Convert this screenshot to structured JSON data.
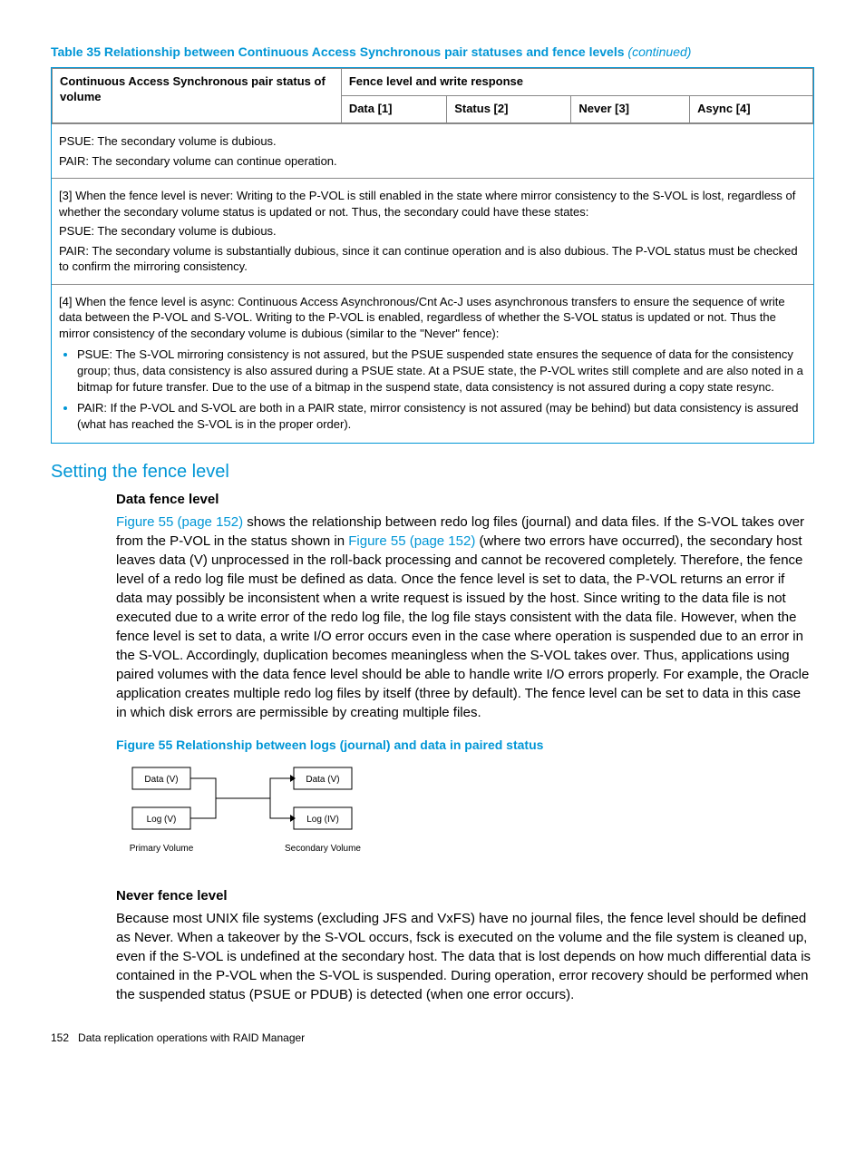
{
  "table": {
    "caption_main": "Table 35 Relationship between Continuous Access Synchronous pair statuses and fence levels",
    "caption_suffix": "(continued)",
    "row_header": "Continuous Access Synchronous pair status of volume",
    "group_header": "Fence level and write response",
    "cols": [
      "Data [1]",
      "Status [2]",
      "Never [3]",
      "Async [4]"
    ],
    "note2a": "PSUE: The secondary volume is dubious.",
    "note2b": "PAIR: The secondary volume can continue operation.",
    "note3a": "[3] When the fence level is never: Writing to the P-VOL is still enabled in the state where mirror consistency to the S-VOL is lost, regardless of whether the secondary volume status is updated or not. Thus, the secondary could have these states:",
    "note3b": "PSUE: The secondary volume is dubious.",
    "note3c": "PAIR: The secondary volume is substantially dubious, since it can continue operation and is also dubious. The P-VOL status must be checked to confirm the mirroring consistency.",
    "note4a": "[4] When the fence level is async: Continuous Access Asynchronous/Cnt Ac-J uses asynchronous transfers to ensure the sequence of write data between the P-VOL and S-VOL. Writing to the P-VOL is enabled, regardless of whether the S-VOL status is updated or not. Thus the mirror consistency of the secondary volume is dubious (similar to the \"Never\" fence):",
    "note4_li1": "PSUE: The S-VOL mirroring consistency is not assured, but the PSUE suspended state ensures the sequence of data for the consistency group; thus, data consistency is also assured during a PSUE state. At a PSUE state, the P-VOL writes still complete and are also noted in a bitmap for future transfer. Due to the use of a bitmap in the suspend state, data consistency is not assured during a copy state resync.",
    "note4_li2": "PAIR: If the P-VOL and S-VOL are both in a PAIR state, mirror consistency is not assured (may be behind) but data consistency is assured (what has reached the S-VOL is in the proper order)."
  },
  "section_heading": "Setting the fence level",
  "data_fence": {
    "heading": "Data fence level",
    "link1": "Figure 55 (page 152)",
    "text1a": " shows the relationship between redo log files (journal) and data files. If the S-VOL takes over from the P-VOL in the status shown in ",
    "link2": "Figure 55 (page 152)",
    "text1b": " (where two errors have occurred), the secondary host leaves data (V) unprocessed in the roll-back processing and cannot be recovered completely. Therefore, the fence level of a redo log file must be defined as data. Once the fence level is set to data, the P-VOL returns an error if data may possibly be inconsistent when a write request is issued by the host. Since writing to the data file is not executed due to a write error of the redo log file, the log file stays consistent with the data file. However, when the fence level is set to data, a write I/O error occurs even in the case where operation is suspended due to an error in the S-VOL. Accordingly, duplication becomes meaningless when the S-VOL takes over. Thus, applications using paired volumes with the data fence level should be able to handle write I/O errors properly. For example, the Oracle application creates multiple redo log files by itself (three by default). The fence level can be set to data in this case in which disk errors are permissible by creating multiple files."
  },
  "figure": {
    "caption": "Figure 55 Relationship between logs (journal) and data in paired status",
    "box_pv_data": "Data (V)",
    "box_pv_log": "Log (V)",
    "box_sv_data": "Data (V)",
    "box_sv_log": "Log (IV)",
    "label_primary": "Primary Volume",
    "label_secondary": "Secondary Volume"
  },
  "never_fence": {
    "heading": "Never fence level",
    "text": "Because most UNIX file systems (excluding JFS and VxFS) have no journal files, the fence level should be defined as Never. When a takeover by the S-VOL occurs, fsck is executed on the volume and the file system is cleaned up, even if the S-VOL is undefined at the secondary host. The data that is lost depends on how much differential data is contained in the P-VOL when the S-VOL is suspended. During operation, error recovery should be performed when the suspended status (PSUE or PDUB) is detected (when one error occurs)."
  },
  "footer": {
    "page": "152",
    "title": "Data replication operations with RAID Manager"
  }
}
